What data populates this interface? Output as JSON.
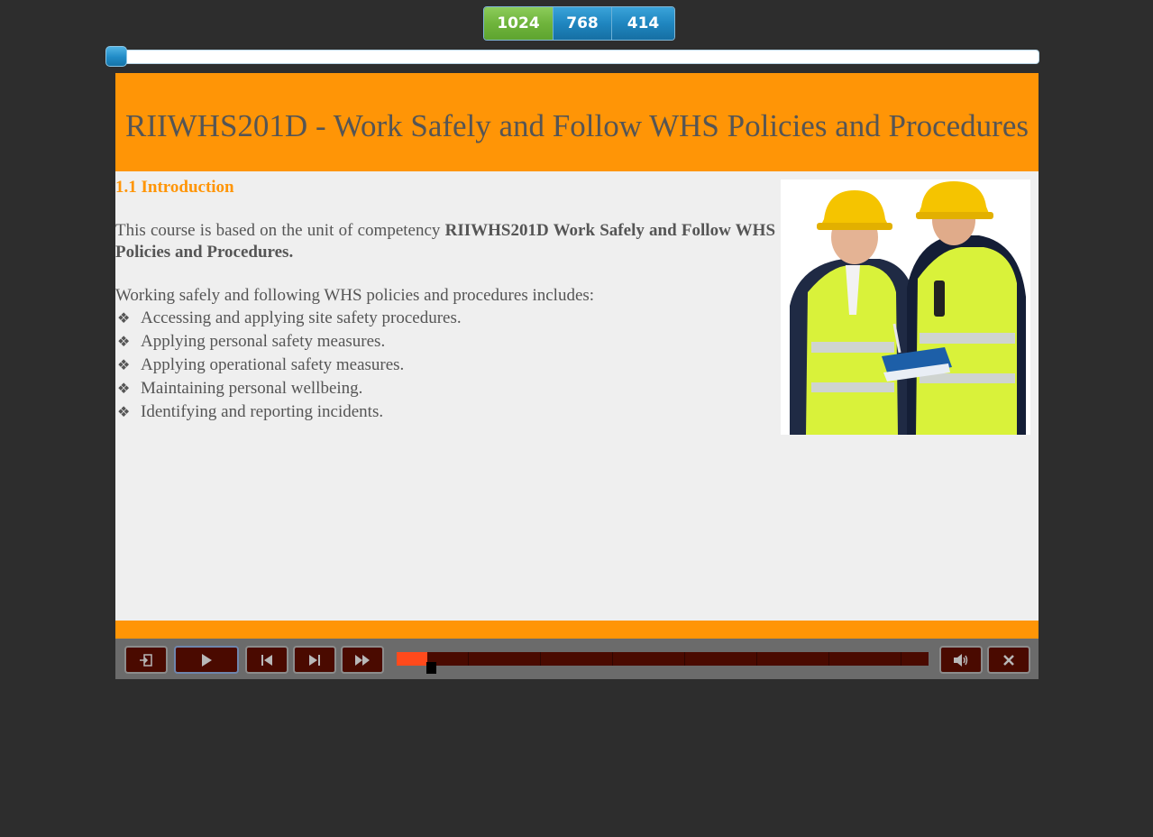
{
  "resolution_switcher": {
    "options": [
      "1024",
      "768",
      "414"
    ],
    "selected": "1024",
    "active_color": "#6fb43c",
    "inactive_color": "#1f86c0"
  },
  "slider": {
    "position_fraction": 0.0
  },
  "slide": {
    "title": "RIIWHS201D - Work Safely and Follow WHS Policies and Procedures",
    "section_heading": "1.1 Introduction",
    "intro_prefix": "This course is based on the unit of competency ",
    "intro_bold": "RIIWHS201D Work Safely and Follow WHS Policies and Procedures.",
    "lead": "Working safely and following WHS policies and procedures includes:",
    "bullets": [
      "Accessing and applying site safety procedures.",
      "Applying personal safety measures.",
      "Applying operational safety measures.",
      "Maintaining personal wellbeing.",
      "Identifying and reporting incidents."
    ],
    "bullet_glyph": "❖",
    "image": "two-workers-in-hard-hats-and-hi-vis-vests-photo",
    "accent_color": "#ff9506"
  },
  "player": {
    "buttons": {
      "exit": "exit-icon",
      "play": "play-icon",
      "previous": "skip-previous-icon",
      "next": "skip-next-icon",
      "fast_forward": "fast-forward-icon",
      "volume": "volume-icon",
      "close": "close-icon"
    },
    "progress_fraction": 0.058,
    "progress_color": "#ff4a1c"
  }
}
